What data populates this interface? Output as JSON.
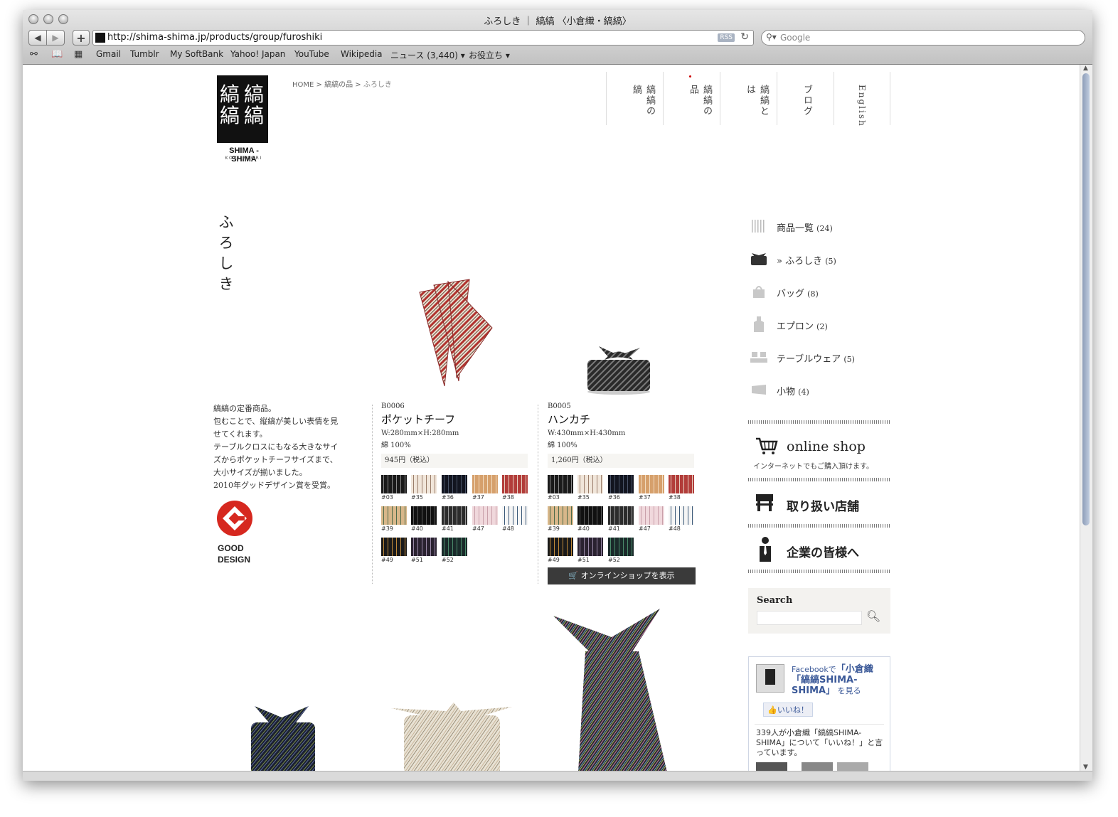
{
  "browser": {
    "window_title": "ふろしき ｜ 縞縞 〈小倉織・縞縞〉",
    "url": "http://shima-shima.jp/products/group/furoshiki",
    "rss": "RSS",
    "search_placeholder": "Google",
    "bookmarks": [
      "Gmail",
      "Tumblr",
      "My SoftBank",
      "Yahoo! Japan",
      "YouTube",
      "Wikipedia",
      "ニュース (3,440) ▾",
      "お役立ち ▾"
    ]
  },
  "site": {
    "logo_name": "SHIMA - SHIMA",
    "logo_sub": "KOKURAORI",
    "breadcrumb": {
      "home": "HOME",
      "sep1": " > ",
      "products": "縞縞の品",
      "sep2": " > ",
      "current": "ふろしき"
    },
    "nav": [
      "縞縞の縞",
      "縞縞の品",
      "縞縞とは",
      "ブログ",
      "English"
    ],
    "active_nav_index": 1
  },
  "page": {
    "title": "ふろしき",
    "description": [
      "縞縞の定番商品。",
      "包むことで、縦縞が美しい表情を見",
      "せてくれます。",
      "テーブルクロスにもなる大きなサイ",
      "ズからポケットチーフサイズまで、",
      "大小サイズが揃いました。",
      "2010年グッドデザイン賞を受賞。"
    ],
    "good_design_line1": "GOOD",
    "good_design_line2": "DESIGN"
  },
  "products": [
    {
      "code": "B0006",
      "name": "ポケットチーフ",
      "size": "W:280mm×H:280mm",
      "material": "綿 100%",
      "price": "945円（税込）",
      "swatches": [
        {
          "label": "#03",
          "c1": "#1a1a1a",
          "c2": "#8a8a8a"
        },
        {
          "label": "#35",
          "c1": "#f1e6da",
          "c2": "#9a7d6a"
        },
        {
          "label": "#36",
          "c1": "#121520",
          "c2": "#4a5468"
        },
        {
          "label": "#37",
          "c1": "#d6a06c",
          "c2": "#f2dcc0"
        },
        {
          "label": "#38",
          "c1": "#b23d3a",
          "c2": "#e6cfc0"
        },
        {
          "label": "#39",
          "c1": "#d8b78a",
          "c2": "#4e6b4a"
        },
        {
          "label": "#40",
          "c1": "#111111",
          "c2": "#5a5a5a"
        },
        {
          "label": "#41",
          "c1": "#2c2c2c",
          "c2": "#9a9a9a"
        },
        {
          "label": "#47",
          "c1": "#f0d8dc",
          "c2": "#c9a0aa"
        },
        {
          "label": "#48",
          "c1": "#f5f5f5",
          "c2": "#3a5878"
        },
        {
          "label": "#49",
          "c1": "#1a1a1a",
          "c2": "#c08a3a"
        },
        {
          "label": "#51",
          "c1": "#2a2230",
          "c2": "#9a8aa8"
        },
        {
          "label": "#52",
          "c1": "#1a2a2a",
          "c2": "#4a8a6a"
        }
      ]
    },
    {
      "code": "B0005",
      "name": "ハンカチ",
      "size": "W:430mm×H:430mm",
      "material": "綿 100%",
      "price": "1,260円（税込）",
      "swatches": [
        {
          "label": "#03",
          "c1": "#1a1a1a",
          "c2": "#8a8a8a"
        },
        {
          "label": "#35",
          "c1": "#f1e6da",
          "c2": "#9a7d6a"
        },
        {
          "label": "#36",
          "c1": "#121520",
          "c2": "#4a5468"
        },
        {
          "label": "#37",
          "c1": "#d6a06c",
          "c2": "#f2dcc0"
        },
        {
          "label": "#38",
          "c1": "#b23d3a",
          "c2": "#e6cfc0"
        },
        {
          "label": "#39",
          "c1": "#d8b78a",
          "c2": "#4e6b4a"
        },
        {
          "label": "#40",
          "c1": "#111111",
          "c2": "#5a5a5a"
        },
        {
          "label": "#41",
          "c1": "#2c2c2c",
          "c2": "#9a9a9a"
        },
        {
          "label": "#47",
          "c1": "#f0d8dc",
          "c2": "#c9a0aa"
        },
        {
          "label": "#48",
          "c1": "#f5f5f5",
          "c2": "#3a5878"
        },
        {
          "label": "#49",
          "c1": "#1a1a1a",
          "c2": "#c08a3a"
        },
        {
          "label": "#51",
          "c1": "#2a2230",
          "c2": "#9a8aa8"
        },
        {
          "label": "#52",
          "c1": "#1a2a2a",
          "c2": "#4a8a6a"
        }
      ],
      "shop_button": "オンラインショップを表示"
    }
  ],
  "sidebar": {
    "categories": [
      {
        "label": "商品一覧",
        "count": "(24)",
        "icon": "striped-fabric-icon"
      },
      {
        "label": "» ふろしき",
        "count": "(5)",
        "icon": "furoshiki-icon"
      },
      {
        "label": "バッグ",
        "count": "(8)",
        "icon": "bag-icon"
      },
      {
        "label": "エプロン",
        "count": "(2)",
        "icon": "apron-icon"
      },
      {
        "label": "テーブルウェア",
        "count": "(5)",
        "icon": "tableware-icon"
      },
      {
        "label": "小物",
        "count": "(4)",
        "icon": "accessory-icon"
      }
    ],
    "online_shop_title": "online shop",
    "online_shop_sub": "インターネットでもご購入頂けます。",
    "stores_title": "取り扱い店舗",
    "business_title": "企業の皆様へ",
    "search_label": "Search",
    "facebook": {
      "prefix": "Facebookで",
      "page_name": "「小倉織「縞縞SHIMA-SHIMA」",
      "suffix": "を見る",
      "like": "いいね！",
      "stats": "339人が小倉織「縞縞SHIMA-SHIMA」について「いいね！」と言っています。"
    }
  }
}
